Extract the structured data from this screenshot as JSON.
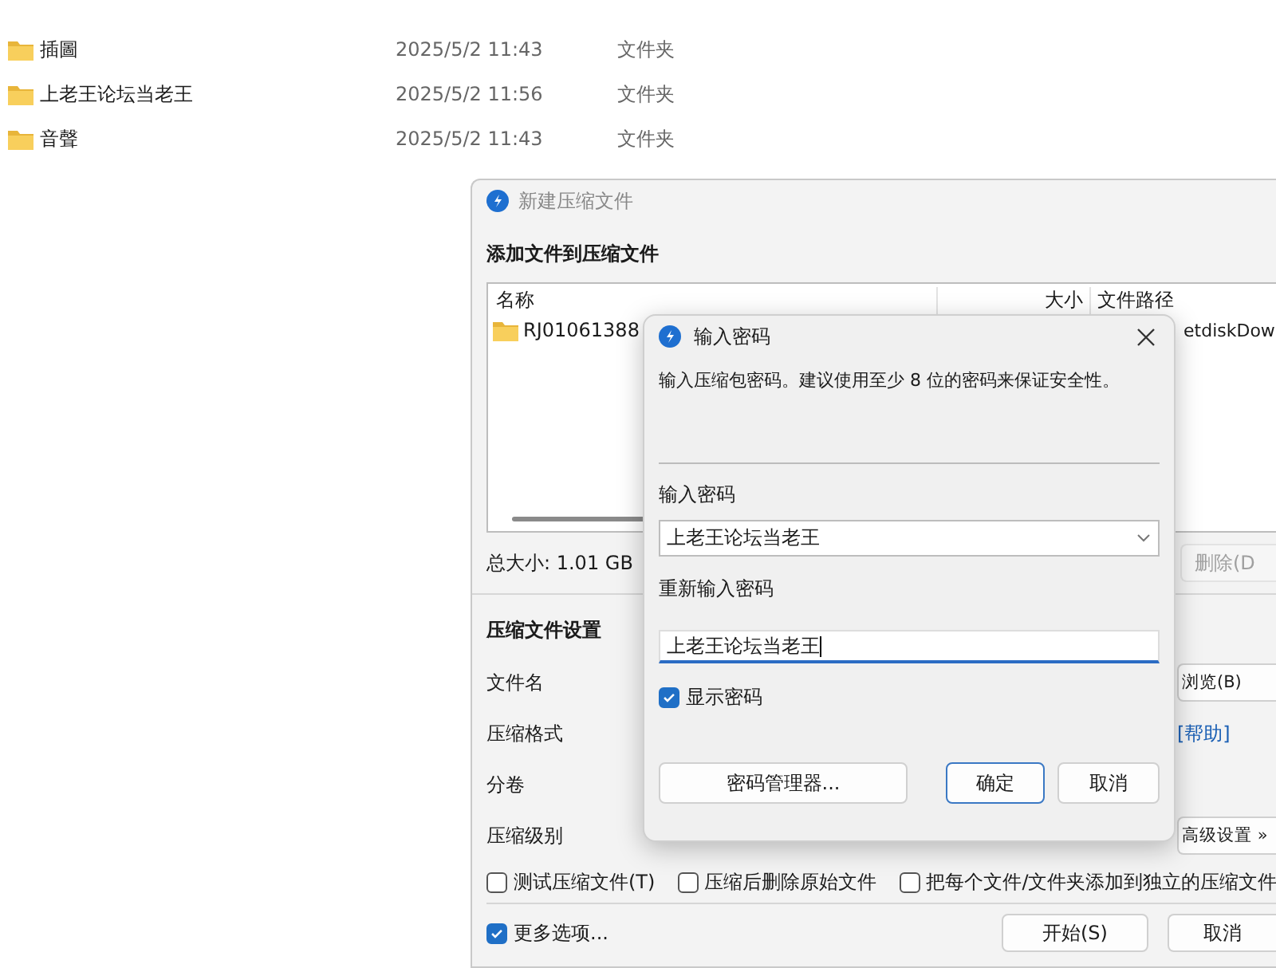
{
  "explorer": {
    "rows": [
      {
        "name": "插圖",
        "modified": "2025/5/2 11:43",
        "type": "文件夹"
      },
      {
        "name": "上老王论坛当老王",
        "modified": "2025/5/2 11:56",
        "type": "文件夹"
      },
      {
        "name": "音聲",
        "modified": "2025/5/2 11:43",
        "type": "文件夹"
      }
    ]
  },
  "main_window": {
    "title": "新建压缩文件",
    "heading": "添加文件到压缩文件",
    "file_list": {
      "columns": [
        "名称",
        "大小",
        "文件路径"
      ],
      "rows": [
        {
          "name": "RJ01061388",
          "path": "etdiskDow"
        }
      ]
    },
    "total_size": "总大小: 1.01 GB",
    "delete_button": {
      "label": "删除(D",
      "disabled": true
    },
    "settings_heading": "压缩文件设置",
    "fields": [
      {
        "label": "文件名",
        "action": {
          "kind": "button",
          "label": "浏览(B)"
        }
      },
      {
        "label": "压缩格式",
        "action": {
          "kind": "link",
          "label": "[帮助]"
        }
      },
      {
        "label": "分卷"
      },
      {
        "label": "压缩级别",
        "action": {
          "kind": "button",
          "label": "高级设置 »"
        }
      }
    ],
    "options": [
      {
        "label": "测试压缩文件(T)",
        "checked": false
      },
      {
        "label": "压缩后删除原始文件",
        "checked": false
      },
      {
        "label": "把每个文件/文件夹添加到独立的压缩文件",
        "checked": false
      }
    ],
    "more_options": {
      "label": "更多选项...",
      "checked": true
    },
    "buttons": [
      "开始(S)",
      "取消"
    ]
  },
  "password_dialog": {
    "title": "输入密码",
    "description": "输入压缩包密码。建议使用至少 8 位的密码来保证安全性。",
    "password_label": "输入密码",
    "password_value": "上老王论坛当老王",
    "confirm_label": "重新输入密码",
    "confirm_value": "上老王论坛当老王",
    "show_password": {
      "label": "显示密码",
      "checked": true
    },
    "buttons": [
      {
        "label": "密码管理器...",
        "default": false
      },
      {
        "label": "确定",
        "default": true
      },
      {
        "label": "取消",
        "default": false
      }
    ]
  }
}
